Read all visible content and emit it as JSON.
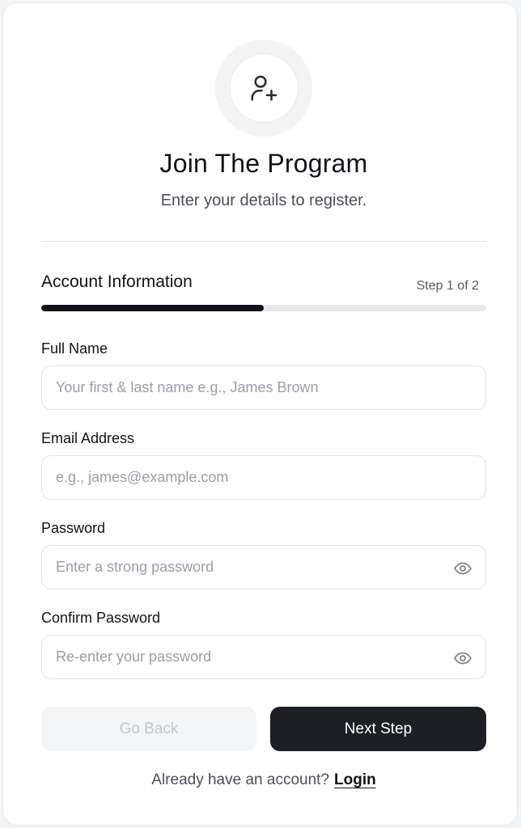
{
  "header": {
    "icon": "user-plus-icon",
    "title": "Join The Program",
    "subtitle": "Enter your details to register."
  },
  "step": {
    "section_title": "Account Information",
    "label": "Step 1 of 2",
    "progress": 0.5
  },
  "fields": {
    "full_name": {
      "label": "Full Name",
      "value": "",
      "placeholder": "Your first & last name e.g., James Brown"
    },
    "email": {
      "label": "Email Address",
      "value": "",
      "placeholder": "e.g., james@example.com"
    },
    "password": {
      "label": "Password",
      "value": "",
      "placeholder": "Enter a strong password",
      "icon": "eye-icon"
    },
    "confirm_password": {
      "label": "Confirm Password",
      "value": "",
      "placeholder": "Re-enter your password",
      "icon": "eye-icon"
    }
  },
  "actions": {
    "back_label": "Go Back",
    "next_label": "Next Step"
  },
  "footer": {
    "prompt": "Already have an account?",
    "login_label": "Login"
  },
  "colors": {
    "primary": "#1d1f24",
    "progress_track": "#e6e7ea",
    "disabled_text": "#c2c5cb"
  }
}
